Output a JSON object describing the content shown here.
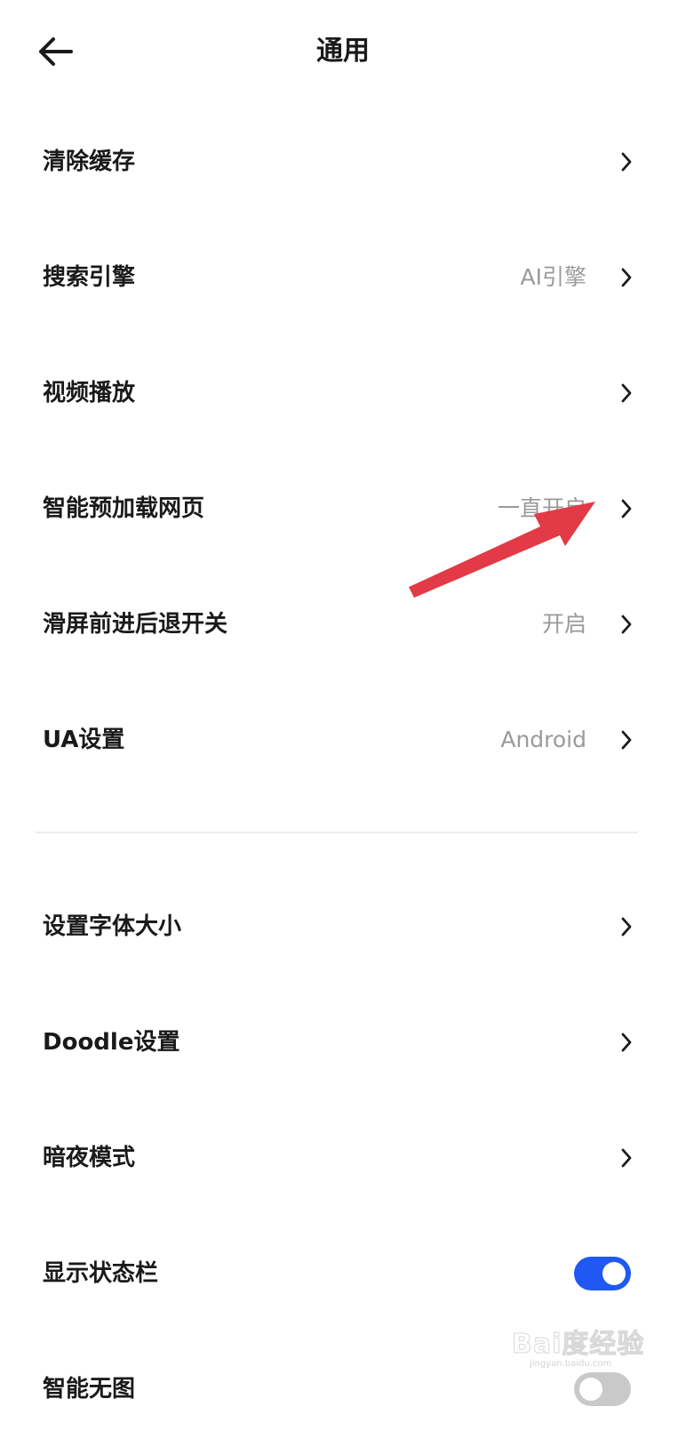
{
  "header": {
    "title": "通用",
    "back_icon": "arrow-left-icon"
  },
  "section1": {
    "items": [
      {
        "label": "清除缓存",
        "value": "",
        "control": "chevron"
      },
      {
        "label": "搜索引擎",
        "value": "AI引擎",
        "control": "chevron"
      },
      {
        "label": "视频播放",
        "value": "",
        "control": "chevron"
      },
      {
        "label": "智能预加载网页",
        "value": "一直开启",
        "control": "chevron"
      },
      {
        "label": "滑屏前进后退开关",
        "value": "开启",
        "control": "chevron"
      },
      {
        "label": "UA设置",
        "value": "Android",
        "control": "chevron"
      }
    ]
  },
  "section2": {
    "items": [
      {
        "label": "设置字体大小",
        "control": "chevron"
      },
      {
        "label": "Doodle设置",
        "control": "chevron"
      },
      {
        "label": "暗夜模式",
        "control": "chevron"
      },
      {
        "label": "显示状态栏",
        "control": "toggle",
        "toggle_on": true
      },
      {
        "label": "智能无图",
        "control": "toggle",
        "toggle_on": false
      }
    ]
  },
  "annotation": {
    "arrow_color": "#e23a46"
  },
  "watermark": {
    "main": "Bai度经验",
    "sub": "jingyan.baidu.com"
  },
  "colors": {
    "accent": "#1f58f2",
    "text_primary": "#1a1a1a",
    "text_secondary": "#9a9a9a",
    "toggle_off": "#c9c9c9"
  }
}
